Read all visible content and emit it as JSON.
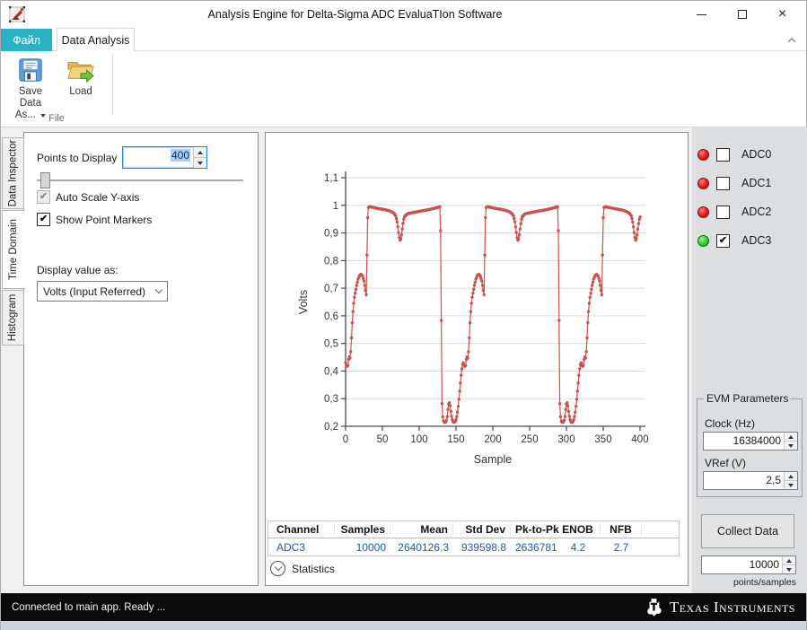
{
  "window": {
    "title": "Analysis Engine for Delta-Sigma ADC EvaluaTIon Software"
  },
  "tabs": {
    "file": "Файл",
    "data_analysis": "Data Analysis"
  },
  "ribbon": {
    "save_line1": "Save Data",
    "save_line2": "As...",
    "load_label": "Load",
    "group_label": "File"
  },
  "side_tabs": [
    {
      "label": "Data Inspector",
      "active": false
    },
    {
      "label": "Time Domain",
      "active": true
    },
    {
      "label": "Histogram",
      "active": false
    }
  ],
  "left_panel": {
    "points_label": "Points to Display",
    "points_value": "400",
    "auto_scale_label": "Auto Scale Y-axis",
    "auto_scale_checked": true,
    "auto_scale_disabled": true,
    "show_markers_label": "Show Point Markers",
    "show_markers_checked": true,
    "display_value_label": "Display value as:",
    "display_value_selected": "Volts (Input Referred)"
  },
  "channels": [
    {
      "name": "ADC0",
      "led": "red",
      "checked": false
    },
    {
      "name": "ADC1",
      "led": "red",
      "checked": false
    },
    {
      "name": "ADC2",
      "led": "red",
      "checked": false
    },
    {
      "name": "ADC3",
      "led": "green",
      "checked": true
    }
  ],
  "evm": {
    "title": "EVM Parameters",
    "clock_label": "Clock (Hz)",
    "clock_value": "16384000",
    "vref_label": "VRef (V)",
    "vref_value": "2,5"
  },
  "collect": {
    "button_label": "Collect Data",
    "samples_value": "10000",
    "samples_unit": "points/samples"
  },
  "table": {
    "headers": [
      "Channel",
      "Samples",
      "Mean",
      "Std Dev",
      "Pk-to-Pk",
      "ENOB",
      "NFB"
    ],
    "rows": [
      [
        "ADC3",
        "10000",
        "2640126.3",
        "939598.8",
        "2636781",
        "4.2",
        "2.7"
      ]
    ]
  },
  "expander": {
    "label": "Statistics"
  },
  "status": {
    "text": "Connected to main app.  Ready ..."
  },
  "brand": {
    "name": "Texas Instruments"
  },
  "icons": {
    "close": "×",
    "check": "✔",
    "app": "red-chart-app-icon",
    "save": "floppy-disk",
    "load": "open-folder-green-arrow",
    "collapse_ribbon": "chevron-up",
    "combo": "chevron-down",
    "expander": "chevron-down",
    "spin_up": "triangle-up",
    "spin_down": "triangle-down",
    "ti_bug": "texas-instruments-bug"
  },
  "colors": {
    "accent_tab": "#29b2c4",
    "series": "#c9534f",
    "table_value_blue": "#2458a0",
    "led_red": "#d11313",
    "led_green": "#23c423",
    "selection": "#a9cdf0",
    "focus_border": "#2f7fd0"
  },
  "chart_data": {
    "type": "line",
    "title": "",
    "xlabel": "Sample",
    "ylabel": "Volts",
    "xlim": [
      0,
      400
    ],
    "ylim": [
      0.2,
      1.1
    ],
    "x_ticks": [
      0,
      50,
      100,
      150,
      200,
      250,
      300,
      350,
      400
    ],
    "y_tick_step": 0.1,
    "decimal_comma": true,
    "grid": "horizontal",
    "legend": "none",
    "marker": "dot",
    "line_color": "#c9534f",
    "series_name": "ADC3",
    "n_points": 401,
    "period": 160,
    "period_keypoints": [
      [
        0,
        0.43
      ],
      [
        1,
        0.421
      ],
      [
        2,
        0.417
      ],
      [
        3,
        0.42
      ],
      [
        4,
        0.442
      ],
      [
        5,
        0.451
      ],
      [
        6,
        0.447
      ],
      [
        7,
        0.47
      ],
      [
        8,
        0.52
      ],
      [
        9,
        0.575
      ],
      [
        10,
        0.615
      ],
      [
        11,
        0.645
      ],
      [
        12,
        0.667
      ],
      [
        13,
        0.682
      ],
      [
        15,
        0.71
      ],
      [
        17,
        0.733
      ],
      [
        19,
        0.746
      ],
      [
        21,
        0.75
      ],
      [
        23,
        0.744
      ],
      [
        25,
        0.726
      ],
      [
        26,
        0.71
      ],
      [
        27,
        0.692
      ],
      [
        28,
        0.676
      ],
      [
        29,
        0.82
      ],
      [
        30,
        0.955
      ],
      [
        31,
        0.992
      ],
      [
        33,
        0.995
      ],
      [
        38,
        0.992
      ],
      [
        45,
        0.988
      ],
      [
        52,
        0.985
      ],
      [
        58,
        0.981
      ],
      [
        63,
        0.976
      ],
      [
        66,
        0.97
      ],
      [
        68,
        0.962
      ],
      [
        69,
        0.952
      ],
      [
        70,
        0.94
      ],
      [
        71,
        0.922
      ],
      [
        72,
        0.901
      ],
      [
        73,
        0.883
      ],
      [
        74,
        0.874
      ],
      [
        75,
        0.879
      ],
      [
        76,
        0.893
      ],
      [
        77,
        0.914
      ],
      [
        78,
        0.934
      ],
      [
        79,
        0.949
      ],
      [
        80,
        0.958
      ],
      [
        82,
        0.965
      ],
      [
        85,
        0.97
      ],
      [
        90,
        0.973
      ],
      [
        96,
        0.976
      ],
      [
        102,
        0.979
      ],
      [
        108,
        0.982
      ],
      [
        114,
        0.985
      ],
      [
        120,
        0.989
      ],
      [
        125,
        0.992
      ],
      [
        128,
        0.995
      ],
      [
        129,
        0.908
      ],
      [
        130,
        0.583
      ],
      [
        131,
        0.282
      ],
      [
        132,
        0.234
      ],
      [
        133,
        0.219
      ],
      [
        134,
        0.215
      ],
      [
        135,
        0.214
      ],
      [
        136,
        0.216
      ],
      [
        137,
        0.221
      ],
      [
        138,
        0.235
      ],
      [
        139,
        0.261
      ],
      [
        140,
        0.281
      ],
      [
        141,
        0.285
      ],
      [
        142,
        0.274
      ],
      [
        143,
        0.254
      ],
      [
        144,
        0.236
      ],
      [
        145,
        0.224
      ],
      [
        146,
        0.217
      ],
      [
        147,
        0.214
      ],
      [
        148,
        0.215
      ],
      [
        149,
        0.218
      ],
      [
        150,
        0.224
      ],
      [
        151,
        0.235
      ],
      [
        152,
        0.251
      ],
      [
        153,
        0.272
      ],
      [
        154,
        0.298
      ],
      [
        155,
        0.327
      ],
      [
        156,
        0.357
      ],
      [
        157,
        0.385
      ],
      [
        158,
        0.408
      ],
      [
        159,
        0.424
      ]
    ]
  }
}
